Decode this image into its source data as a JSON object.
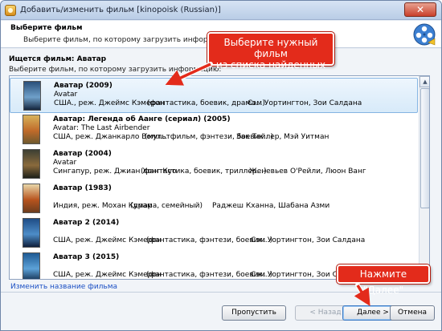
{
  "window": {
    "title": "Добавить/изменить фильм [kinopoisk (Russian)]",
    "close_label": "✕"
  },
  "header": {
    "title": "Выберите фильм",
    "subtitle": "Выберите фильм, по которому загрузить информацию."
  },
  "search": {
    "title": "Ищется фильм: Аватар",
    "subtitle": "Выберите фильм, по которому загрузить информацию:"
  },
  "results": [
    {
      "title": "Аватар (2009)",
      "original": "Avatar",
      "info": "США., реж. Джеймс Кэмерон",
      "genres": "(фантастика, боевик, драма...)",
      "actors": "Сэм Уортингтон, Зои Салдана",
      "poster_colors": [
        "#2a4f7a",
        "#6fa0c9",
        "#14253d"
      ],
      "selected": true
    },
    {
      "title": "Аватар: Легенда об Аанге (сериал) (2005)",
      "original": "Avatar: The Last Airbender",
      "info": "США, реж. Джанкарло Волп...",
      "genres": "(мультфильм, фэнтези, боевик...)",
      "actors": "Зак Тайлер, Мэй Уитман",
      "poster_colors": [
        "#d7b25a",
        "#c06a2a",
        "#6e5a2e"
      ],
      "selected": false
    },
    {
      "title": "Аватар (2004)",
      "original": "Avatar",
      "info": "Сингапур, реж. Джиан Хонг Куо",
      "genres": "(фантастика, боевик, триллер...)",
      "actors": "Женевьев О'Рейли, Люон Ванг",
      "poster_colors": [
        "#3c3f33",
        "#8a6a3c",
        "#1e2119"
      ],
      "selected": false
    },
    {
      "title": "Аватар (1983)",
      "original": "",
      "info": "Индия, реж. Мохан Кумар",
      "genres": "(драма, семейный)",
      "actors": "Раджеш Кханна, Шабана Азми",
      "poster_colors": [
        "#e8d6a8",
        "#b8541e",
        "#6d3d1e"
      ],
      "selected": false
    },
    {
      "title": "Аватар 2 (2014)",
      "original": "",
      "info": "США, реж. Джеймс Кэмерон",
      "genres": "(фантастика, фэнтези, боевик...)",
      "actors": "Сэм Уортингтон, Зои Салдана",
      "poster_colors": [
        "#1f4d86",
        "#4d8dc8",
        "#0f1f3c"
      ],
      "selected": false
    },
    {
      "title": "Аватар 3 (2015)",
      "original": "",
      "info": "США, реж. Джеймс Кэмерон",
      "genres": "(фантастика, фэнтези, боевик...)",
      "actors": "Сэм Уортингтон, Зои Салдана",
      "poster_colors": [
        "#1e5a94",
        "#5da2d8",
        "#112a4a"
      ],
      "selected": false
    }
  ],
  "edit_link": "Изменить название фильма",
  "buttons": {
    "skip": "Пропустить",
    "back": "< Назад",
    "next": "Далее >",
    "cancel": "Отмена"
  },
  "callouts": {
    "top_line1": "Выберите нужный фильм",
    "top_line2": "из списка найденных",
    "bottom": "Нажмите \"Далее\""
  },
  "colors": {
    "callout": "#e32b1b",
    "selection": "#d7eaf9",
    "link": "#1a4fc4"
  }
}
